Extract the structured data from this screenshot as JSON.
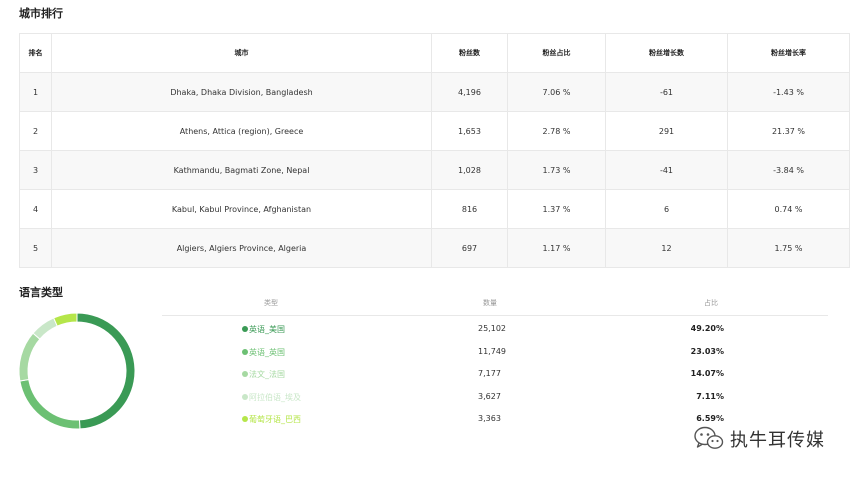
{
  "city_section": {
    "title": "城市排行",
    "columns": [
      "排名",
      "城市",
      "粉丝数",
      "粉丝占比",
      "粉丝增长数",
      "粉丝增长率"
    ],
    "rows": [
      {
        "rank": "1",
        "city": "Dhaka, Dhaka Division, Bangladesh",
        "fans": "4,196",
        "share": "7.06 %",
        "growth": "-61",
        "rate": "-1.43 %"
      },
      {
        "rank": "2",
        "city": "Athens, Attica (region), Greece",
        "fans": "1,653",
        "share": "2.78 %",
        "growth": "291",
        "rate": "21.37 %"
      },
      {
        "rank": "3",
        "city": "Kathmandu, Bagmati Zone, Nepal",
        "fans": "1,028",
        "share": "1.73 %",
        "growth": "-41",
        "rate": "-3.84 %"
      },
      {
        "rank": "4",
        "city": "Kabul, Kabul Province, Afghanistan",
        "fans": "816",
        "share": "1.37 %",
        "growth": "6",
        "rate": "0.74 %"
      },
      {
        "rank": "5",
        "city": "Algiers, Algiers Province, Algeria",
        "fans": "697",
        "share": "1.17 %",
        "growth": "12",
        "rate": "1.75 %"
      }
    ]
  },
  "language_section": {
    "title": "语言类型",
    "columns": [
      "类型",
      "数量",
      "占比"
    ],
    "items": [
      {
        "name": "英语_美国",
        "count": "25,102",
        "pct": "49.20%",
        "value": 49.2,
        "color": "#3a9a55"
      },
      {
        "name": "英语_英国",
        "count": "11,749",
        "pct": "23.03%",
        "value": 23.03,
        "color": "#6cc073"
      },
      {
        "name": "法文_法国",
        "count": "7,177",
        "pct": "14.07%",
        "value": 14.07,
        "color": "#a6d9a2"
      },
      {
        "name": "阿拉伯语_埃及",
        "count": "3,627",
        "pct": "7.11%",
        "value": 7.11,
        "color": "#c9e7c8"
      },
      {
        "name": "葡萄牙语_巴西",
        "count": "3,363",
        "pct": "6.59%",
        "value": 6.59,
        "color": "#b5e64a"
      }
    ]
  },
  "watermark": {
    "text": "执牛耳传媒",
    "icon": "wechat-icon"
  }
}
